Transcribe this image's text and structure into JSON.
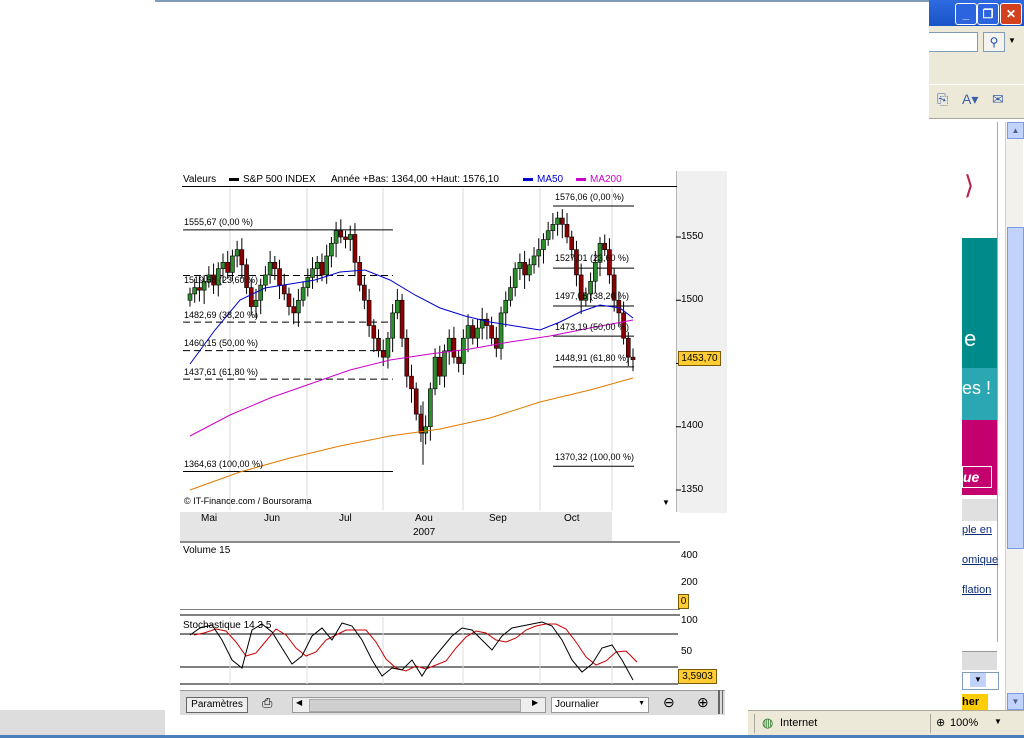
{
  "legend": {
    "valeurs": "Valeurs",
    "index": "S&P 500 INDEX",
    "range": "Année +Bas: 1364,00 +Haut: 1576,10",
    "ma50": "MA50",
    "ma200": "MA200",
    "colors": {
      "index": "#000000",
      "ma50": "#0000cc",
      "ma200": "#cc00cc",
      "ma200_long": "#e07a00"
    }
  },
  "fib_left": [
    "1555,67 (0,00 %)",
    "1519,58 (23,60 %)",
    "1482,69 (38,20 %)",
    "1460,15 (50,00 %)",
    "1437,61 (61,80 %)",
    "1364,63 (100,00 %)"
  ],
  "fib_right": [
    "1576,06 (0,00 %)",
    "1527,01 (23,60 %)",
    "1497,05 (38,20 %)",
    "1473,19 (50,00 %)",
    "1448,91 (61,80 %)",
    "1370,32 (100,00 %)"
  ],
  "price_axis": [
    "1550",
    "1500",
    "1450",
    "1400",
    "1350"
  ],
  "last_price": "1453,70",
  "credit": "© IT-Finance.com / Boursorama",
  "months": [
    "Mai",
    "Jun",
    "Jul",
    "Aou",
    "Sep",
    "Oct"
  ],
  "year": "2007",
  "volume": {
    "label": "Volume 15",
    "axis": [
      "400",
      "200"
    ],
    "value": "0"
  },
  "stoch": {
    "label": "Stochastique 14 3 5",
    "axis": [
      "100",
      "50"
    ],
    "value": "3,5903"
  },
  "toolbar": {
    "params": "Paramètres",
    "print_icon": "printer-icon",
    "period": "Journalier",
    "zoom_out": "zoom-out-icon",
    "zoom_in": "zoom-in-icon"
  },
  "browser": {
    "right_teal_text": "e",
    "right_promo": "es !",
    "right_promo_box": "ue",
    "right_links": [
      "ple en",
      "omique",
      "flation"
    ],
    "right_yellow": "her",
    "status_zone": "Internet",
    "zoom": "100%"
  },
  "chart_data": {
    "type": "candlestick",
    "title": "S&P 500 INDEX",
    "xlabel": "2007",
    "categories": [
      "Mai",
      "Jun",
      "Jul",
      "Aou",
      "Sep",
      "Oct"
    ],
    "ylim": [
      1340,
      1590
    ],
    "series": [
      {
        "name": "MA50",
        "approx_values": [
          1455,
          1490,
          1525,
          1520,
          1490,
          1470,
          1490,
          1480,
          1490,
          1510
        ]
      },
      {
        "name": "MA200",
        "approx_values": [
          1393,
          1413,
          1430,
          1446,
          1458,
          1462,
          1466,
          1472,
          1478,
          1486
        ]
      }
    ],
    "last": 1453.7,
    "high": 1576.1,
    "low": 1364.0
  }
}
